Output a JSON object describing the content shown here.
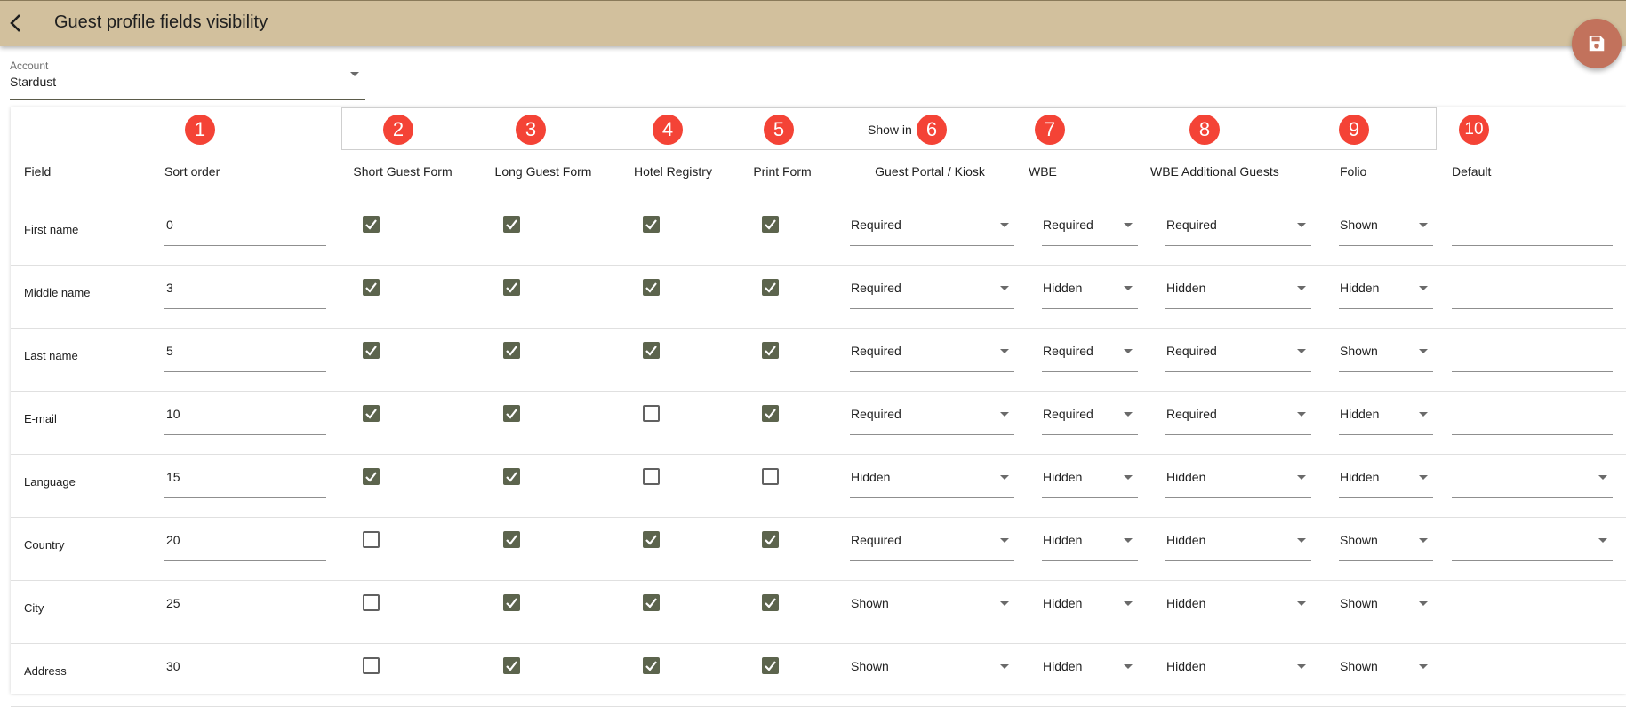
{
  "header": {
    "title": "Guest profile fields visibility"
  },
  "account": {
    "label": "Account",
    "value": "Stardust"
  },
  "group": {
    "show_in_label": "Show in"
  },
  "badges": [
    "1",
    "2",
    "3",
    "4",
    "5",
    "6",
    "7",
    "8",
    "9",
    "10"
  ],
  "columns": {
    "field": "Field",
    "sort_order": "Sort order",
    "short_form": "Short Guest Form",
    "long_form": "Long Guest Form",
    "hotel_registry": "Hotel Registry",
    "print_form": "Print Form",
    "guest_portal": "Guest Portal / Kiosk",
    "wbe": "WBE",
    "wbe_additional": "WBE Additional Guests",
    "folio": "Folio",
    "default": "Default"
  },
  "rows": [
    {
      "field": "First name",
      "sort": "0",
      "short": true,
      "long": true,
      "hotel": true,
      "print": true,
      "portal": "Required",
      "wbe": "Required",
      "wbe_add": "Required",
      "folio": "Shown",
      "default_dropdown": false
    },
    {
      "field": "Middle name",
      "sort": "3",
      "short": true,
      "long": true,
      "hotel": true,
      "print": true,
      "portal": "Required",
      "wbe": "Hidden",
      "wbe_add": "Hidden",
      "folio": "Hidden",
      "default_dropdown": false
    },
    {
      "field": "Last name",
      "sort": "5",
      "short": true,
      "long": true,
      "hotel": true,
      "print": true,
      "portal": "Required",
      "wbe": "Required",
      "wbe_add": "Required",
      "folio": "Shown",
      "default_dropdown": false
    },
    {
      "field": "E-mail",
      "sort": "10",
      "short": true,
      "long": true,
      "hotel": false,
      "print": true,
      "portal": "Required",
      "wbe": "Required",
      "wbe_add": "Required",
      "folio": "Hidden",
      "default_dropdown": false
    },
    {
      "field": "Language",
      "sort": "15",
      "short": true,
      "long": true,
      "hotel": false,
      "print": false,
      "portal": "Hidden",
      "wbe": "Hidden",
      "wbe_add": "Hidden",
      "folio": "Hidden",
      "default_dropdown": true
    },
    {
      "field": "Country",
      "sort": "20",
      "short": false,
      "long": true,
      "hotel": true,
      "print": true,
      "portal": "Required",
      "wbe": "Hidden",
      "wbe_add": "Hidden",
      "folio": "Shown",
      "default_dropdown": true
    },
    {
      "field": "City",
      "sort": "25",
      "short": false,
      "long": true,
      "hotel": true,
      "print": true,
      "portal": "Shown",
      "wbe": "Hidden",
      "wbe_add": "Hidden",
      "folio": "Shown",
      "default_dropdown": false
    },
    {
      "field": "Address",
      "sort": "30",
      "short": false,
      "long": true,
      "hotel": true,
      "print": true,
      "portal": "Shown",
      "wbe": "Hidden",
      "wbe_add": "Hidden",
      "folio": "Shown",
      "default_dropdown": false
    }
  ],
  "colors": {
    "header_bg": "#d2c09d",
    "fab": "#c2725c",
    "badge": "#f44336",
    "checkbox": "#5c644d"
  },
  "icons": {
    "back": "arrow-left-icon",
    "save": "floppy-disk-icon",
    "dropdown": "caret-down-icon",
    "check": "check-icon"
  }
}
